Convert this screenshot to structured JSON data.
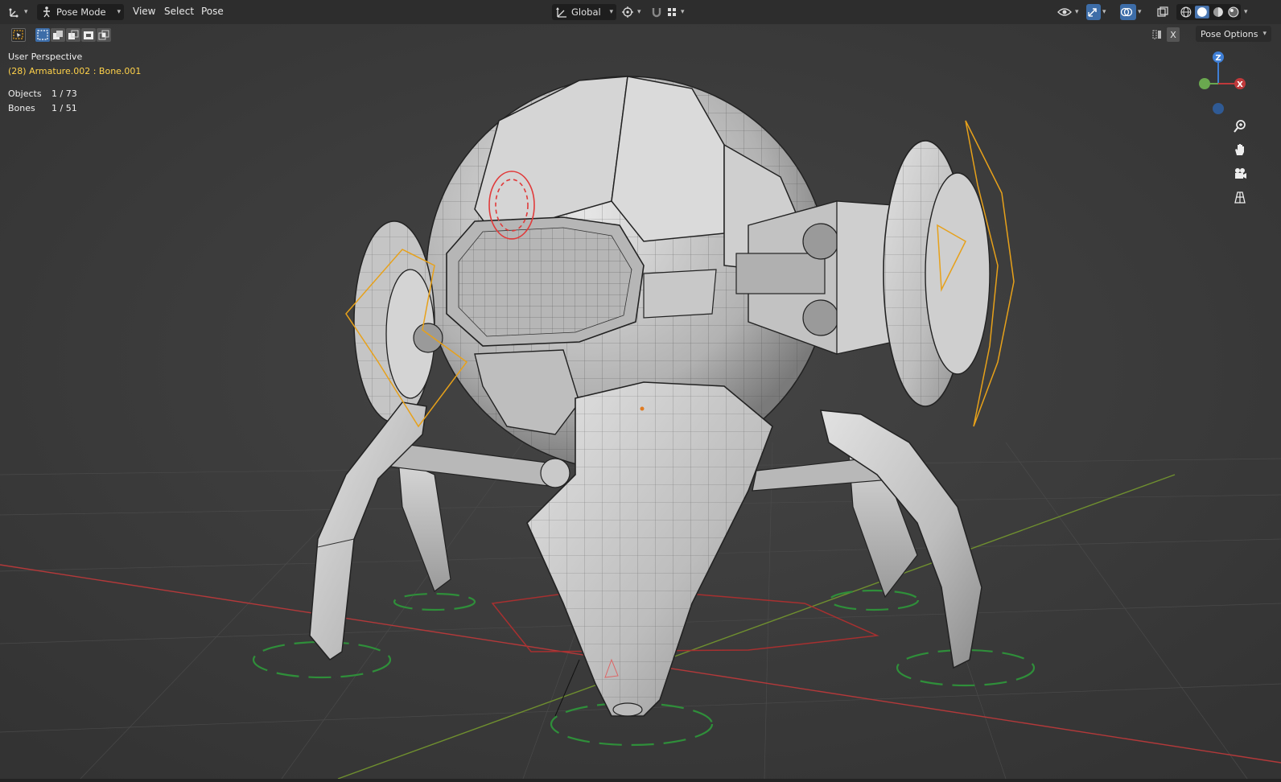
{
  "header": {
    "mode_label": "Pose Mode",
    "menus": [
      "View",
      "Select",
      "Pose"
    ],
    "transform_orientation": "Global",
    "pose_options_label": "Pose Options",
    "x_mirror_label": "X"
  },
  "viewport": {
    "view_name": "User Perspective",
    "active_info": "(28) Armature.002 : Bone.001",
    "stats": [
      {
        "label": "Objects",
        "value": "1 / 73"
      },
      {
        "label": "Bones",
        "value": "1 / 51"
      }
    ]
  },
  "gizmo": {
    "z_label": "Z",
    "x_label": "X"
  },
  "colors": {
    "viewport_bg": "#3d3d3d",
    "header_bg": "#2d2d2d",
    "active_info": "#ffd24a",
    "x_axis": "#c0393b",
    "y_axis": "#6aa84f",
    "z_axis": "#3f7fd6",
    "selected_bone": "#e7a11a"
  },
  "icons": {
    "editor_type": "axis-icon",
    "mode": "pose-mode-icon",
    "orientation": "orientation-icon",
    "pivot": "pivot-icon",
    "snap": "snap-icon",
    "proportional": "proportional-icon",
    "visibility": "eye-icon",
    "gizmos": "gizmo-icon",
    "overlays": "overlays-icon",
    "xray": "xray-icon",
    "shading": [
      "wireframe-shading-icon",
      "solid-shading-icon",
      "material-shading-icon",
      "rendered-shading-icon"
    ],
    "nav": [
      "zoom-icon",
      "hand-icon",
      "camera-icon",
      "grid-view-icon"
    ]
  }
}
